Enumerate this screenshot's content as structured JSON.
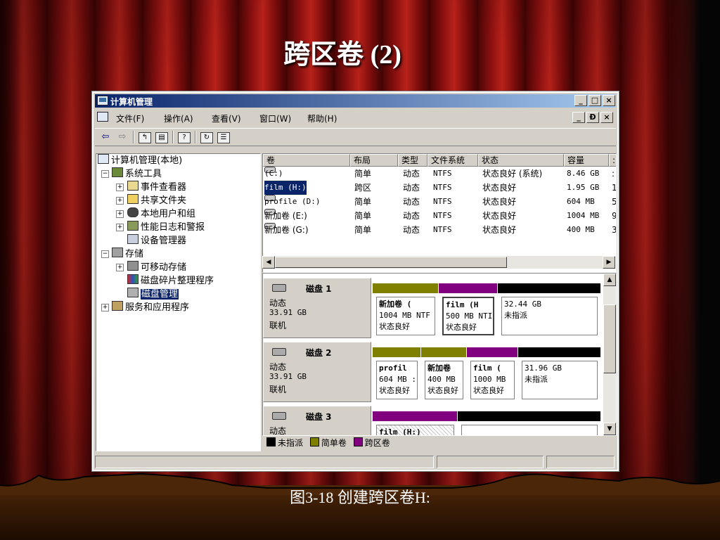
{
  "slide": {
    "title": "跨区卷 (2)",
    "caption": "图3-18  创建跨区卷H:"
  },
  "window": {
    "title": "计算机管理",
    "controls": [
      "_",
      "□",
      "×"
    ],
    "child_controls": [
      "_",
      "Ð",
      "×"
    ]
  },
  "menu": [
    "文件(F)",
    "操作(A)",
    "查看(V)",
    "窗口(W)",
    "帮助(H)"
  ],
  "tree": [
    {
      "label": "计算机管理(本地)",
      "icon": "computer-icon"
    },
    {
      "label": "系统工具",
      "icon": "tools-icon"
    },
    {
      "label": "事件查看器",
      "icon": "event-viewer-icon"
    },
    {
      "label": "共享文件夹",
      "icon": "shared-folder-icon"
    },
    {
      "label": "本地用户和组",
      "icon": "users-icon"
    },
    {
      "label": "性能日志和警报",
      "icon": "performance-icon"
    },
    {
      "label": "设备管理器",
      "icon": "device-manager-icon"
    },
    {
      "label": "存储",
      "icon": "storage-icon"
    },
    {
      "label": "可移动存储",
      "icon": "removable-storage-icon"
    },
    {
      "label": "磁盘碎片整理程序",
      "icon": "defrag-icon"
    },
    {
      "label": "磁盘管理",
      "icon": "disk-management-icon"
    },
    {
      "label": "服务和应用程序",
      "icon": "services-icon"
    }
  ],
  "volumes": {
    "columns": [
      "卷",
      "布局",
      "类型",
      "文件系统",
      "状态",
      "容量",
      ":"
    ],
    "rows": [
      [
        "(C:)",
        "简单",
        "动态",
        "NTFS",
        "状态良好 (系统)",
        "8.46 GB",
        ":"
      ],
      [
        "film (H:)",
        "跨区",
        "动态",
        "NTFS",
        "状态良好",
        "1.95 GB",
        "1"
      ],
      [
        "profile (D:)",
        "简单",
        "动态",
        "NTFS",
        "状态良好",
        "604 MB",
        "5"
      ],
      [
        "新加卷 (E:)",
        "简单",
        "动态",
        "NTFS",
        "状态良好",
        "1004 MB",
        "9"
      ],
      [
        "新加卷 (G:)",
        "简单",
        "动态",
        "NTFS",
        "状态良好",
        "400 MB",
        "3"
      ]
    ]
  },
  "disks": [
    {
      "name": "磁盘 1",
      "type": "动态",
      "size": "33.91 GB",
      "status": "联机",
      "parts": [
        {
          "name": "新加卷  (",
          "l2": "1004 MB NTF",
          "l3": "状态良好",
          "color": "#808000"
        },
        {
          "name": "film  (H",
          "l2": "500 MB NTI",
          "l3": "状态良好",
          "color": "#800080"
        },
        {
          "name": "",
          "l2": "32.44 GB",
          "l3": "未指派",
          "color": "#000000"
        }
      ]
    },
    {
      "name": "磁盘 2",
      "type": "动态",
      "size": "33.91 GB",
      "status": "联机",
      "parts": [
        {
          "name": "profil",
          "l2": "604 MB :",
          "l3": "状态良好",
          "color": "#808000"
        },
        {
          "name": "新加卷",
          "l2": "400 MB",
          "l3": "状态良好",
          "color": "#808000"
        },
        {
          "name": "film  (",
          "l2": "1000 MB",
          "l3": "状态良好",
          "color": "#800080"
        },
        {
          "name": "",
          "l2": "31.96 GB",
          "l3": "未指派",
          "color": "#000000"
        }
      ]
    },
    {
      "name": "磁盘 3",
      "type": "动态",
      "size": "",
      "status": "",
      "parts": [
        {
          "name": "film  (H:)",
          "l2": "",
          "l3": "",
          "color": "#800080"
        },
        {
          "name": "",
          "l2": "",
          "l3": "",
          "color": "#000000"
        }
      ]
    }
  ],
  "legend": [
    {
      "label": "未指派",
      "color": "#000000"
    },
    {
      "label": "简单卷",
      "color": "#808000"
    },
    {
      "label": "跨区卷",
      "color": "#800080"
    }
  ]
}
